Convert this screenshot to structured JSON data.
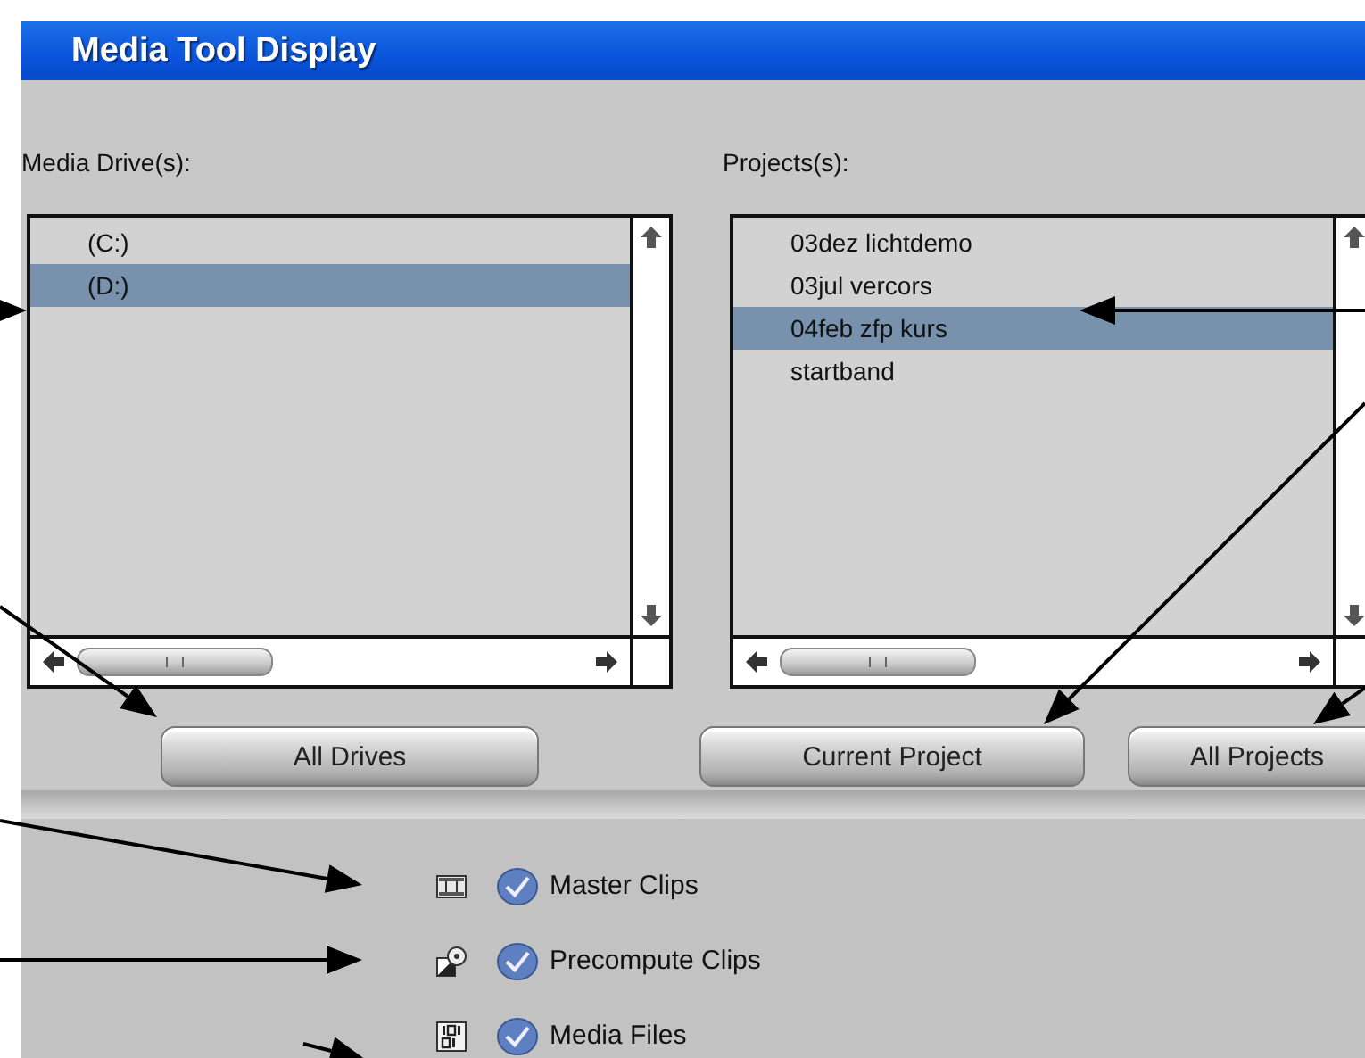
{
  "window": {
    "title": "Media Tool Display"
  },
  "drives": {
    "label": "Media Drive(s):",
    "items": [
      {
        "text": "(C:)",
        "selected": false
      },
      {
        "text": "(D:)",
        "selected": true
      }
    ]
  },
  "projects": {
    "label": "Projects(s):",
    "items": [
      {
        "text": "03dez lichtdemo",
        "selected": false
      },
      {
        "text": "03jul vercors",
        "selected": false
      },
      {
        "text": "04feb zfp kurs",
        "selected": true
      },
      {
        "text": "startband",
        "selected": false
      }
    ]
  },
  "buttons": [
    {
      "label": "All Drives"
    },
    {
      "label": "Current Project"
    },
    {
      "label": "All Projects"
    }
  ],
  "options": [
    {
      "kind": "master",
      "label": "Master Clips",
      "checked": true
    },
    {
      "kind": "precompute",
      "label": "Precompute Clips",
      "checked": true
    },
    {
      "kind": "media",
      "label": "Media Files",
      "checked": true
    }
  ]
}
